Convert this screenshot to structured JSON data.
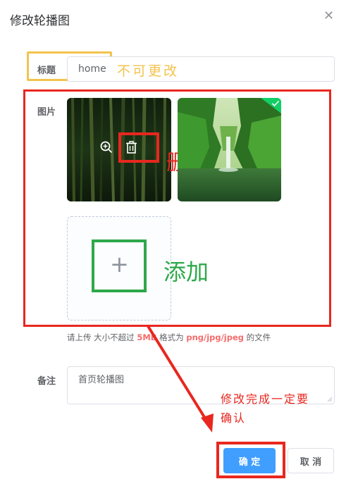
{
  "dialog": {
    "title": "修改轮播图",
    "close_icon": "close-icon"
  },
  "form": {
    "title_label": "标题",
    "title_value": "home",
    "image_label": "图片",
    "upload_hint_prefix": "请上传 大小不超过 ",
    "upload_hint_size": "5MB",
    "upload_hint_middle": " 格式为 ",
    "upload_hint_formats": "png/jpg/jpeg",
    "upload_hint_suffix": " 的文件",
    "remark_label": "备注",
    "remark_value": "首页轮播图"
  },
  "images": [
    {
      "name": "bamboo-forest",
      "actions": [
        "zoom-in-icon",
        "delete-icon"
      ]
    },
    {
      "name": "green-gorge-waterfall",
      "status": "check-icon"
    }
  ],
  "annotations": {
    "not_editable": "不可更改",
    "delete": "删除",
    "add": "添加",
    "confirm_note_line1": "修改完成一定要",
    "confirm_note_line2": "确认"
  },
  "buttons": {
    "confirm": "确 定",
    "cancel": "取 消"
  },
  "colors": {
    "primary": "#409eff",
    "annotation_red": "#e8271f",
    "annotation_yellow": "#f3c34d",
    "annotation_green": "#2ea84a",
    "hint_highlight": "#f56c6c"
  }
}
